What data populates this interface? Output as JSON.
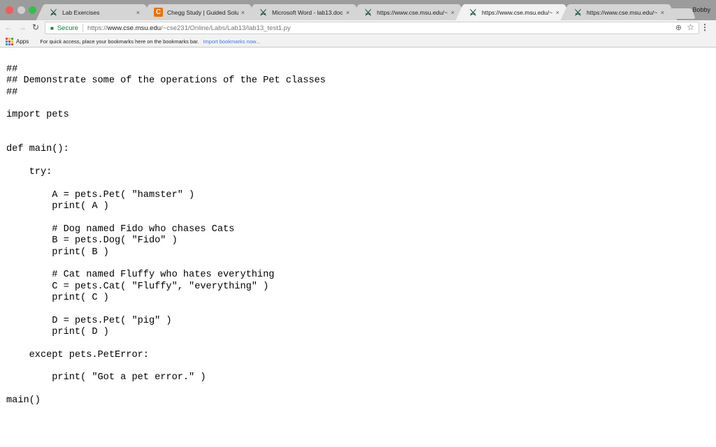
{
  "browser": {
    "tabs": [
      {
        "title": "Lab Exercises",
        "favicon": "msu-spartan-icon",
        "active": false
      },
      {
        "title": "Chegg Study | Guided Solu",
        "favicon": "chegg-icon",
        "active": false
      },
      {
        "title": "Microsoft Word - lab13.doc",
        "favicon": "msu-spartan-icon",
        "active": false
      },
      {
        "title": "https://www.cse.msu.edu/~",
        "favicon": "msu-spartan-icon",
        "active": false
      },
      {
        "title": "https://www.cse.msu.edu/~",
        "favicon": "msu-spartan-icon",
        "active": true
      },
      {
        "title": "https://www.cse.msu.edu/~",
        "favicon": "msu-spartan-icon",
        "active": false
      }
    ],
    "profile_name": "Bobby",
    "address_bar": {
      "security_label": "Secure",
      "url_scheme": "https://",
      "url_host": "www.cse.msu.edu",
      "url_path": "/~cse231/Online/Labs/Lab13/lab13_test1.py"
    },
    "bookmarks_bar": {
      "apps_label": "Apps",
      "hint": "For quick access, place your bookmarks here on the bookmarks bar.",
      "import_link": "Import bookmarks now..."
    },
    "colors": {
      "secure_green": "#0b8043",
      "link_blue": "#3b78e7",
      "chegg_orange": "#eb7100",
      "msu_green": "#1b4d3e"
    }
  },
  "page": {
    "code": "##\n## Demonstrate some of the operations of the Pet classes\n##\n\nimport pets\n\n\ndef main():\n\n    try:\n\n        A = pets.Pet( \"hamster\" )\n        print( A )\n\n        # Dog named Fido who chases Cats\n        B = pets.Dog( \"Fido\" )\n        print( B )\n\n        # Cat named Fluffy who hates everything\n        C = pets.Cat( \"Fluffy\", \"everything\" )\n        print( C )\n\n        D = pets.Pet( \"pig\" )\n        print( D )\n\n    except pets.PetError:\n\n        print( \"Got a pet error.\" )\n\nmain()"
  },
  "icons": {
    "back": "←",
    "forward": "→",
    "reload": "C",
    "lock": "🔒",
    "zoom": "⊕",
    "star": "☆",
    "menu": "⋮",
    "close": "×",
    "msu": "⚔",
    "chegg": "C"
  }
}
